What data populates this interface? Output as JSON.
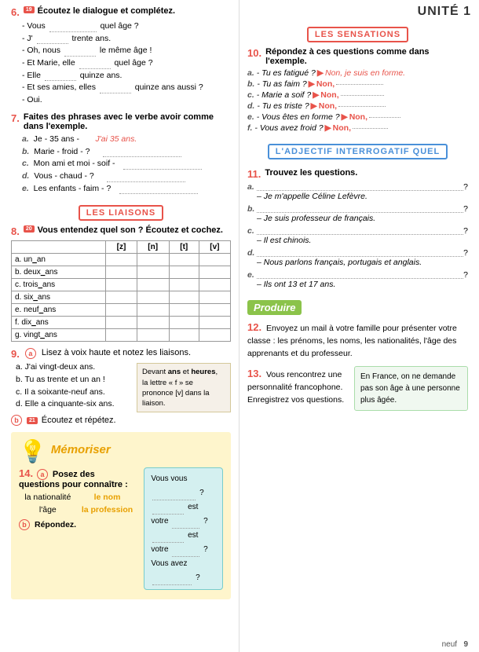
{
  "unit": {
    "title": "UNITÉ 1"
  },
  "exercises": {
    "ex6": {
      "num": "6.",
      "badge": "19",
      "title": "Écoutez le dialogue et complétez.",
      "lines": [
        "- Vous .......... quel âge ?",
        "- J' .......... trente ans.",
        "- Oh, nous .......... le même âge !",
        "- Et Marie, elle .......... quel âge ?",
        "- Elle .......... quinze ans.",
        "- Et ses amies, elles .......... quinze ans aussi ?",
        "- Oui."
      ]
    },
    "ex7": {
      "num": "7.",
      "title": "Faites des phrases avec le verbe avoir comme dans l'exemple.",
      "items": [
        {
          "label": "a.",
          "text": "Je - 35 ans -",
          "answer": "J'ai 35 ans."
        },
        {
          "label": "b.",
          "text": "Marie - froid - ?",
          "answer": ""
        },
        {
          "label": "c.",
          "text": "Mon ami et moi - soif -",
          "answer": ""
        },
        {
          "label": "d.",
          "text": "Vous - chaud - ?",
          "answer": ""
        },
        {
          "label": "e.",
          "text": "Les enfants - faim - ?",
          "answer": ""
        }
      ]
    },
    "ex8": {
      "num": "8.",
      "badge": "20",
      "title": "Vous entendez quel son ? Écoutez et cochez.",
      "headers": [
        "",
        "[z]",
        "[n]",
        "[t]",
        "[v]"
      ],
      "rows": [
        "a. un an",
        "b. deux ans",
        "c. trois ans",
        "d. six ans",
        "e. neuf ans",
        "f. dix ans",
        "g. vingt ans"
      ]
    },
    "ex9": {
      "num": "9.",
      "part_a_title": "Lisez à voix haute et notez les liaisons.",
      "lines": [
        "a. J'ai vingt-deux ans.",
        "b. Tu as trente et un an !",
        "c. Il a soixante-neuf ans.",
        "d. Elle a cinquante-six ans."
      ],
      "note": {
        "bold1": "ans",
        "bold2": "heures",
        "text": ", la lettre « f » se prononce [v] dans la liaison."
      },
      "part_b_badge": "21",
      "part_b_title": "Écoutez et répétez."
    },
    "ex10": {
      "num": "10.",
      "title": "Répondez à ces questions comme dans l'exemple.",
      "items": [
        {
          "label": "a.",
          "question": "Tu es fatigué ?",
          "answer_start": "Non, je suis en forme.",
          "dots": ""
        },
        {
          "label": "b.",
          "question": "Tu as faim ?",
          "prefix": "Non,",
          "dots": true
        },
        {
          "label": "c.",
          "question": "Marie a soif ?",
          "prefix": "Non,",
          "dots": true
        },
        {
          "label": "d.",
          "question": "Tu es triste ?",
          "prefix": "Non,",
          "dots": true
        },
        {
          "label": "e.",
          "question": "Vous êtes en forme ?",
          "prefix": "Non,",
          "dots": true
        },
        {
          "label": "f.",
          "question": "Vous avez froid ?",
          "prefix": "Non,",
          "dots": true
        }
      ]
    },
    "ex11": {
      "num": "11.",
      "title": "Trouvez les questions.",
      "items": [
        {
          "label": "a.",
          "answer": "Je m'appelle Céline Lefèvre."
        },
        {
          "label": "b.",
          "answer": "Je suis professeur de français."
        },
        {
          "label": "c.",
          "answer": "Il est chinois."
        },
        {
          "label": "d.",
          "answer": "Nous parlons français, portugais et anglais."
        },
        {
          "label": "e.",
          "answer": "Ils ont 13 et 17 ans."
        }
      ]
    },
    "ex12": {
      "num": "12.",
      "text": "Envoyez un mail à votre famille pour présenter votre classe : les prénoms, les noms, les nationalités, l'âge des apprenants et du professeur."
    },
    "ex13": {
      "num": "13.",
      "text": "Vous rencontrez une personnalité francophone. Enregistrez vos questions.",
      "info_box": "En France, on ne demande pas son âge à une personne plus âgée."
    },
    "ex14": {
      "num": "14.",
      "circle": "a",
      "title": "Posez des questions pour connaître :",
      "concepts": [
        {
          "text": "la nationalité",
          "type": "normal"
        },
        {
          "text": "le nom",
          "type": "highlight"
        },
        {
          "text": "l'âge",
          "type": "normal"
        },
        {
          "text": "la profession",
          "type": "highlight"
        }
      ],
      "circle_b": "b",
      "part_b": "Répondez.",
      "chat_lines": [
        "Vous vous ................................ ?",
        "................................ est votre .................. ?",
        "................................ est votre .................. ?",
        "Vous avez ................................ ?"
      ]
    }
  },
  "banners": {
    "liaisons": "LES LIAISONS",
    "sensations": "LES SENSATIONS",
    "adjectif": "L'ADJECTIF INTERROGATIF QUEL",
    "produire": "Produire",
    "memoriser": "Mémoriser"
  },
  "footer": {
    "text": "neuf",
    "page": "9"
  }
}
